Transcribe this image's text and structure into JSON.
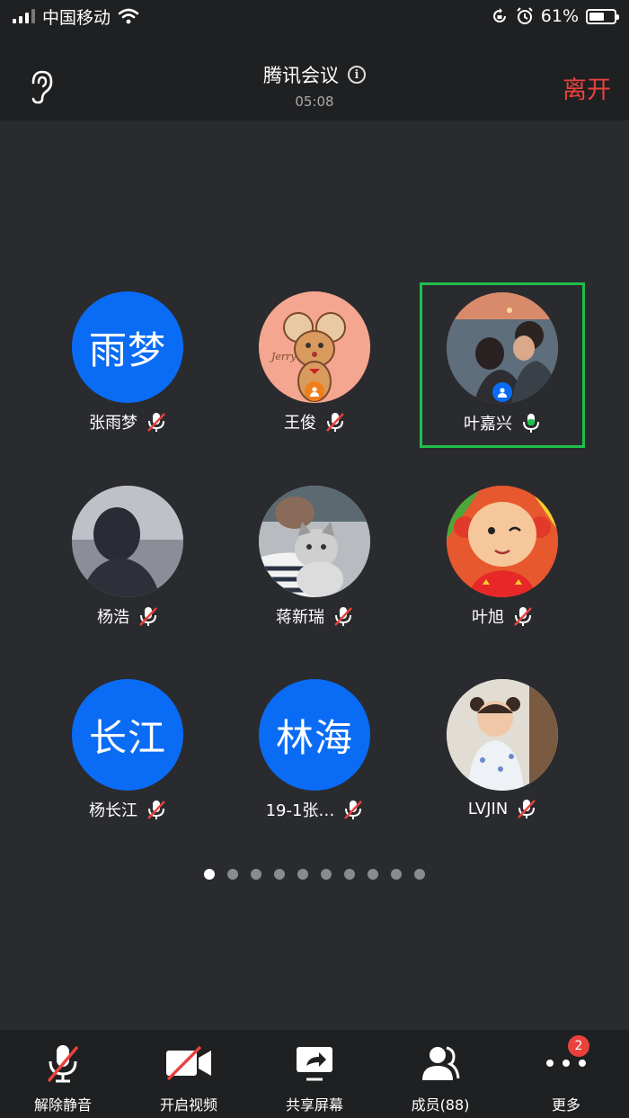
{
  "status_bar": {
    "carrier": "中国移动",
    "battery_percent": "61%",
    "battery_level": 0.61
  },
  "header": {
    "title": "腾讯会议",
    "timer": "05:08",
    "leave_label": "离开"
  },
  "participants": [
    {
      "name": "张雨梦",
      "avatar_text": "雨梦",
      "mic": "muted",
      "badge": ""
    },
    {
      "name": "王俊",
      "avatar_text": "",
      "mic": "muted",
      "badge": "orange"
    },
    {
      "name": "叶嘉兴",
      "avatar_text": "",
      "mic": "on",
      "badge": "blue",
      "speaking": true
    },
    {
      "name": "杨浩",
      "avatar_text": "",
      "mic": "muted",
      "badge": ""
    },
    {
      "name": "蒋新瑞",
      "avatar_text": "",
      "mic": "muted",
      "badge": ""
    },
    {
      "name": "叶旭",
      "avatar_text": "",
      "mic": "muted",
      "badge": ""
    },
    {
      "name": "杨长江",
      "avatar_text": "长江",
      "mic": "muted",
      "badge": ""
    },
    {
      "name": "19-1张…",
      "avatar_text": "林海",
      "mic": "muted",
      "badge": ""
    },
    {
      "name": "LVJIN",
      "avatar_text": "",
      "mic": "muted",
      "badge": ""
    }
  ],
  "pager": {
    "total": 10,
    "current": 1
  },
  "toolbar": {
    "unmute": "解除静音",
    "video": "开启视频",
    "share": "共享屏幕",
    "members": "成员(88)",
    "more": "更多",
    "more_badge": "2"
  },
  "colors": {
    "accent_blue": "#0a6cf5",
    "leave_red": "#e9423d",
    "speaking_green": "#1fbf4c"
  }
}
